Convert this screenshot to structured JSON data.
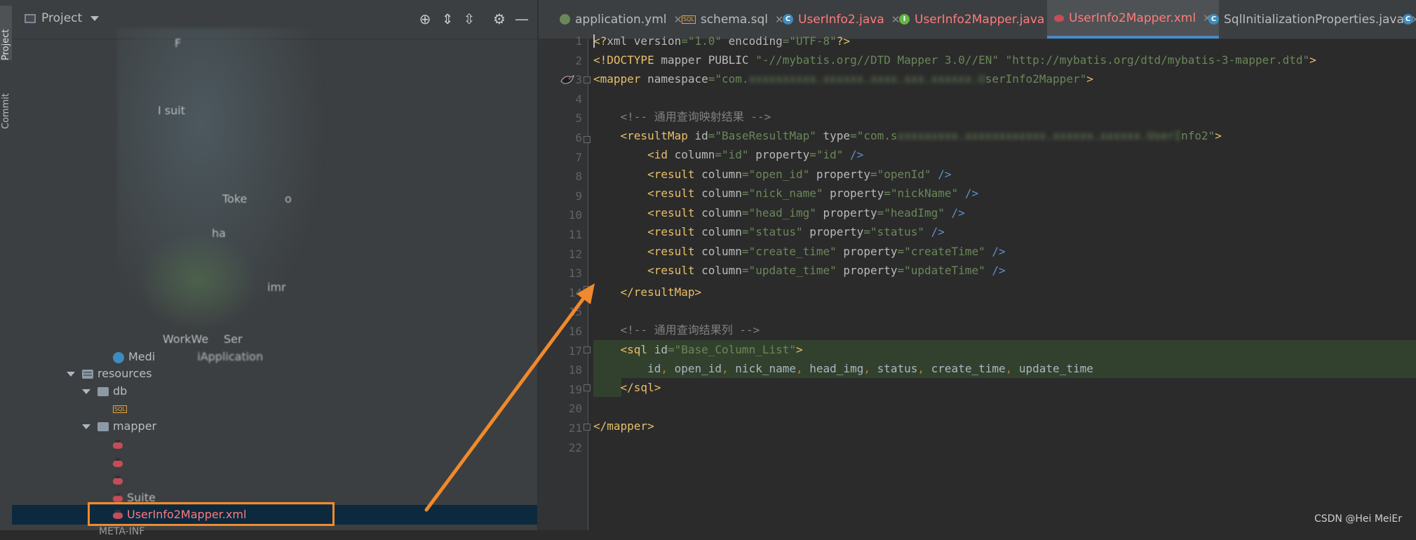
{
  "side_tabs": {
    "project": "Project",
    "commit": "Commit"
  },
  "project_panel": {
    "title": "Project",
    "tree": {
      "resources": "resources",
      "db": "db",
      "sql_file": "SQL",
      "mapper": "mapper",
      "selected_file": "UserInfo2Mapper.xml",
      "obscured_items": [
        "F",
        "I suit",
        "Toke",
        "o",
        "ha",
        "imr",
        "WorkWe",
        "Ser",
        "Medi",
        "iApplication",
        "Suite",
        "META-INF"
      ]
    }
  },
  "editor_tabs": [
    {
      "label": "application.yml",
      "icon": "yml-icon",
      "active": false
    },
    {
      "label": "schema.sql",
      "icon": "sql-icon",
      "active": false
    },
    {
      "label": "UserInfo2.java",
      "icon": "class-icon",
      "active": false
    },
    {
      "label": "UserInfo2Mapper.java",
      "icon": "interface-icon",
      "active": false
    },
    {
      "label": "UserInfo2Mapper.xml",
      "icon": "xml-icon",
      "active": true
    },
    {
      "label": "SqlInitializationProperties.java",
      "icon": "class-icon",
      "active": false
    }
  ],
  "code": {
    "line_numbers": [
      "1",
      "2",
      "3",
      "4",
      "5",
      "6",
      "7",
      "8",
      "9",
      "10",
      "11",
      "12",
      "13",
      "14",
      "15",
      "16",
      "17",
      "18",
      "19",
      "20",
      "21",
      "22"
    ],
    "l1": {
      "a": "<?",
      "b": "xml ",
      "c": "version",
      "d": "=\"1.0\"",
      "e": " encoding",
      "f": "=\"UTF-8\"",
      "g": "?>"
    },
    "l2": {
      "a": "<!DOCTYPE ",
      "b": "mapper ",
      "c": "PUBLIC ",
      "d": "\"-//mybatis.org//DTD Mapper 3.0//EN\" ",
      "e": "\"http://mybatis.org/dtd/mybatis-3-mapper.dtd\"",
      "f": ">"
    },
    "l3": {
      "a": "<mapper ",
      "b": "namespace",
      "c": "=\"com.",
      "blur": "xxxxxxxxxx.xxxxxx.xxxx.xxx.xxxxxx.U",
      "d": "serInfo2Mapper\"",
      "e": ">"
    },
    "l5": "<!-- 通用查询映射结果 -->",
    "l6": {
      "a": "<resultMap ",
      "b": "id",
      "c": "=\"BaseResultMap\" ",
      "d": "type",
      "e": "=\"com.s",
      "blur": "xxxxxxxxx.xxxxxxxxxxxx.xxxxxx.xxxxxx.UserI",
      "f": "nfo2\"",
      "g": ">"
    },
    "result_rows": [
      {
        "tag": "<id ",
        "col_attr": "column",
        "col_val": "=\"id\" ",
        "prop_attr": "property",
        "prop_val": "=\"id\" ",
        "end": "/>"
      },
      {
        "tag": "<result ",
        "col_attr": "column",
        "col_val": "=\"open_id\" ",
        "prop_attr": "property",
        "prop_val": "=\"openId\" ",
        "end": "/>"
      },
      {
        "tag": "<result ",
        "col_attr": "column",
        "col_val": "=\"nick_name\" ",
        "prop_attr": "property",
        "prop_val": "=\"nickName\" ",
        "end": "/>"
      },
      {
        "tag": "<result ",
        "col_attr": "column",
        "col_val": "=\"head_img\" ",
        "prop_attr": "property",
        "prop_val": "=\"headImg\" ",
        "end": "/>"
      },
      {
        "tag": "<result ",
        "col_attr": "column",
        "col_val": "=\"status\" ",
        "prop_attr": "property",
        "prop_val": "=\"status\" ",
        "end": "/>"
      },
      {
        "tag": "<result ",
        "col_attr": "column",
        "col_val": "=\"create_time\" ",
        "prop_attr": "property",
        "prop_val": "=\"createTime\" ",
        "end": "/>"
      },
      {
        "tag": "<result ",
        "col_attr": "column",
        "col_val": "=\"update_time\" ",
        "prop_attr": "property",
        "prop_val": "=\"updateTime\" ",
        "end": "/>"
      }
    ],
    "l14": "</resultMap>",
    "l16": "<!-- 通用查询结果列 -->",
    "l17": {
      "a": "<sql ",
      "b": "id",
      "c": "=\"Base_Column_List\"",
      "d": ">"
    },
    "l18": {
      "a": "id",
      "b": ", ",
      "c": "open_id",
      "d": ", ",
      "e": "nick_name",
      "f": ", ",
      "g": "head_img",
      "h": ", ",
      "i": "status",
      "j": ", ",
      "k": "create_time",
      "l": ", ",
      "m": "update_time"
    },
    "l19": "</sql>",
    "l21": "</mapper>"
  },
  "watermark": "CSDN @Hei MeiEr",
  "colors": {
    "annotation_orange": "#f08a2c",
    "active_tab_underline": "#4a88c7",
    "selection": "#0d293e"
  }
}
